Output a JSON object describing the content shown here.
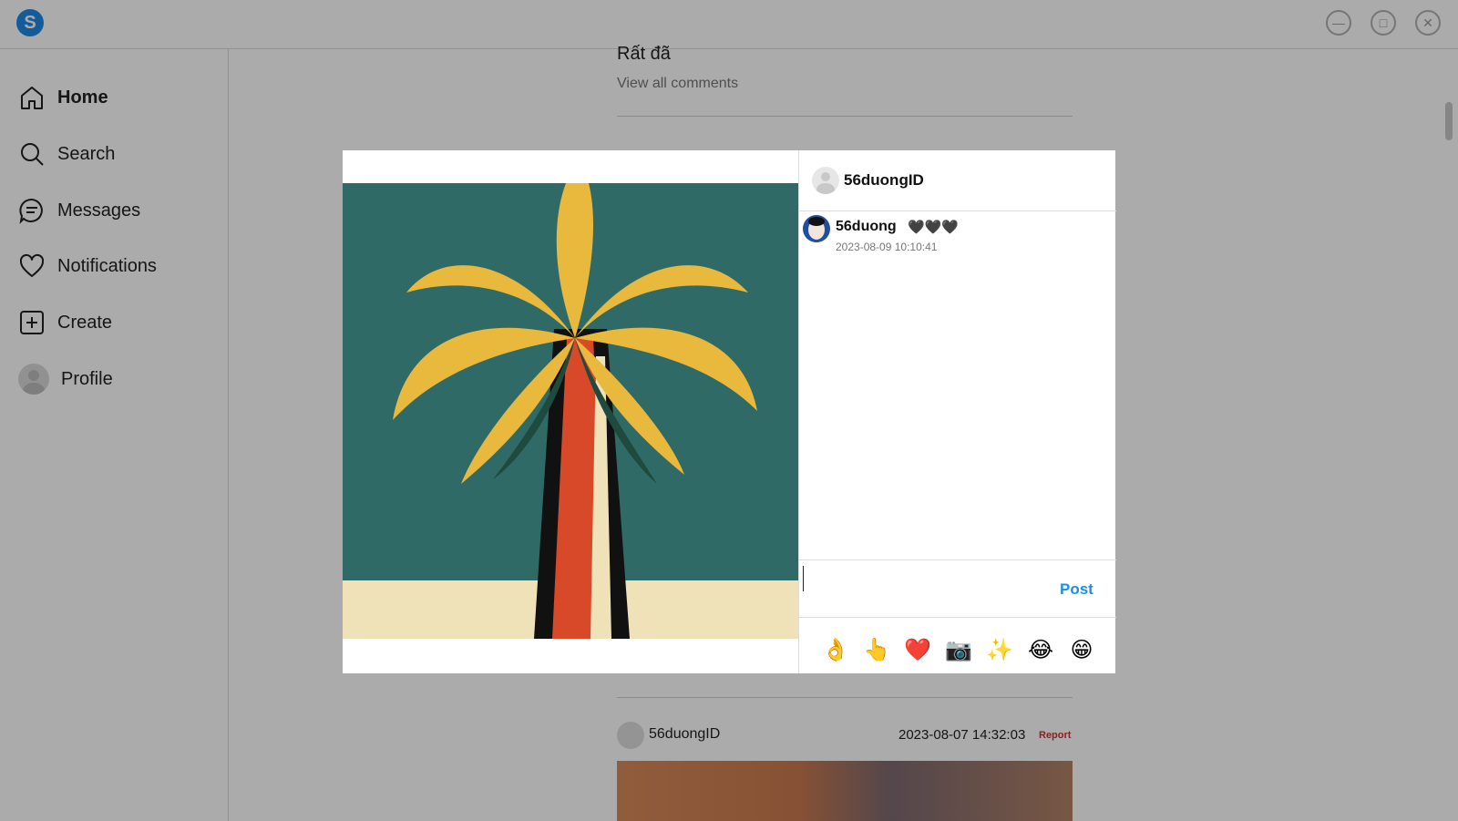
{
  "app": {
    "logo_letter": "S"
  },
  "sidebar": {
    "items": [
      {
        "label": "Home",
        "icon": "home-icon",
        "active": true
      },
      {
        "label": "Search",
        "icon": "search-icon"
      },
      {
        "label": "Messages",
        "icon": "message-icon"
      },
      {
        "label": "Notifications",
        "icon": "heart-icon"
      },
      {
        "label": "Create",
        "icon": "plus-square-icon"
      },
      {
        "label": "Profile",
        "icon": "avatar"
      }
    ]
  },
  "feed": {
    "prev_comment": "Rất đã",
    "view_all": "View all comments",
    "next_post": {
      "username": "56duongID",
      "timestamp": "2023-08-07 14:32:03",
      "report_label": "Report"
    }
  },
  "modal": {
    "author": "56duongID",
    "comments": [
      {
        "username": "56duong",
        "text": "🖤🖤🖤",
        "timestamp": "2023-08-09 10:10:41"
      }
    ],
    "input": {
      "value": "",
      "placeholder": ""
    },
    "post_label": "Post",
    "emojis": [
      "👌",
      "👆",
      "❤️",
      "📷",
      "✨",
      "😂",
      "😁"
    ]
  },
  "colors": {
    "accent": "#1a8fe3",
    "report": "#d32f2f",
    "overlay": "rgba(0,0,0,0.33)"
  }
}
